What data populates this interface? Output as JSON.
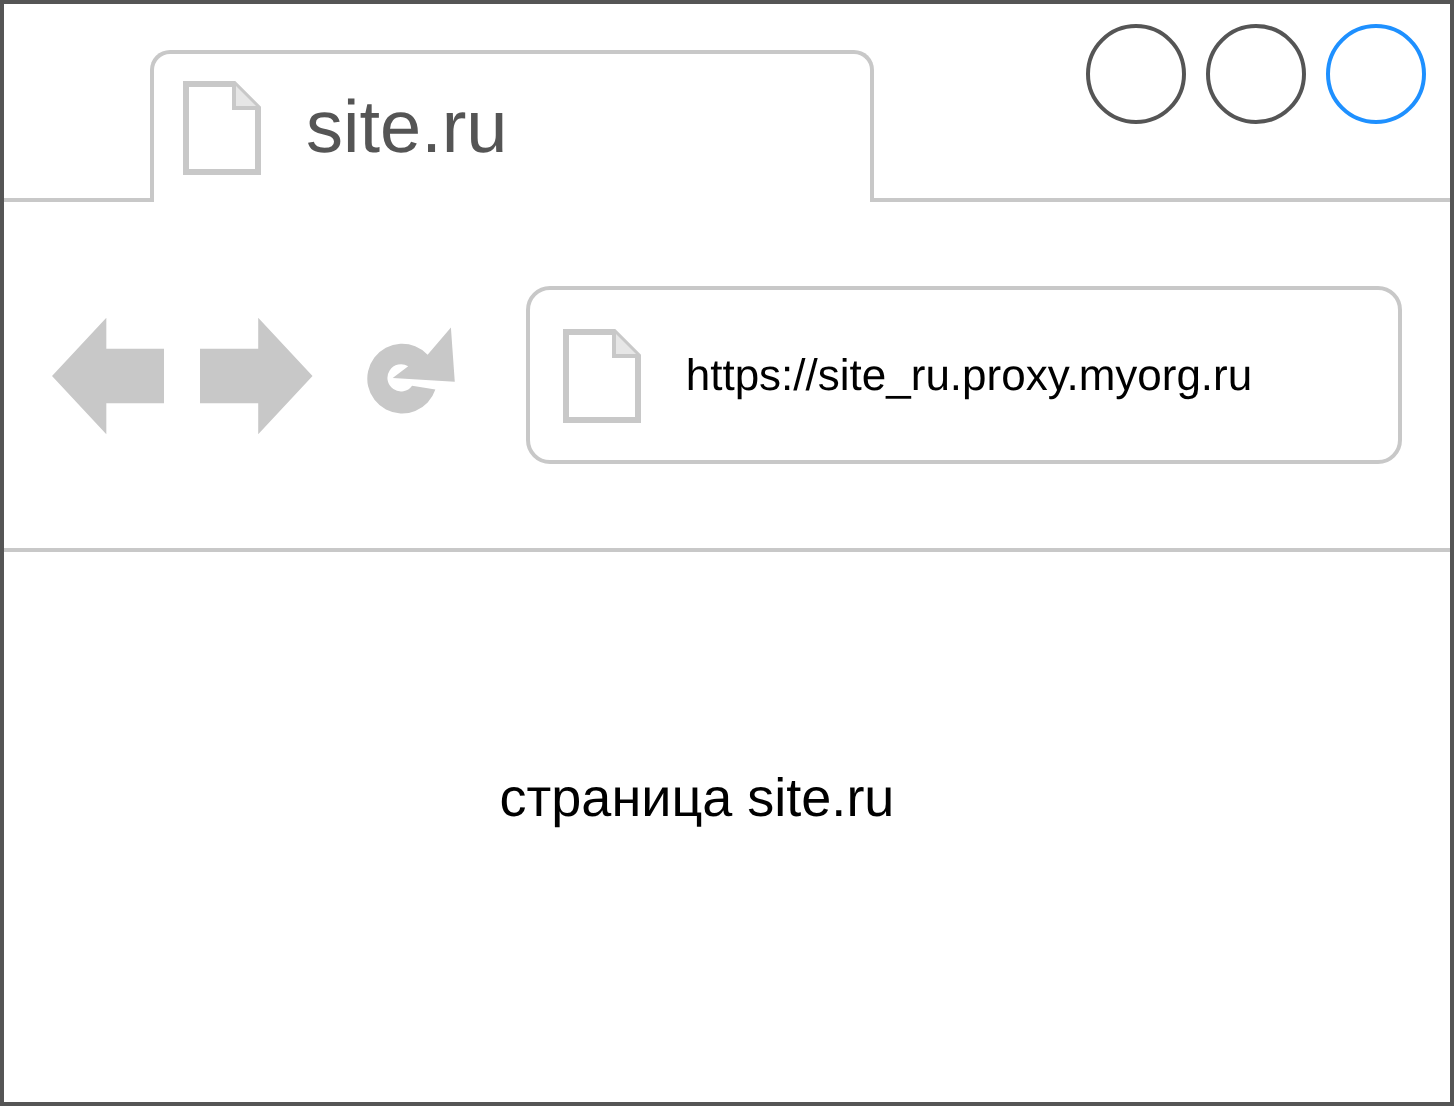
{
  "tab": {
    "title": "site.ru"
  },
  "window_buttons": [
    {
      "color": "#555555"
    },
    {
      "color": "#555555"
    },
    {
      "color": "#1e90ff"
    }
  ],
  "address_bar": {
    "value": "https://site_ru.proxy.myorg.ru"
  },
  "page": {
    "text": "страница site.ru"
  }
}
